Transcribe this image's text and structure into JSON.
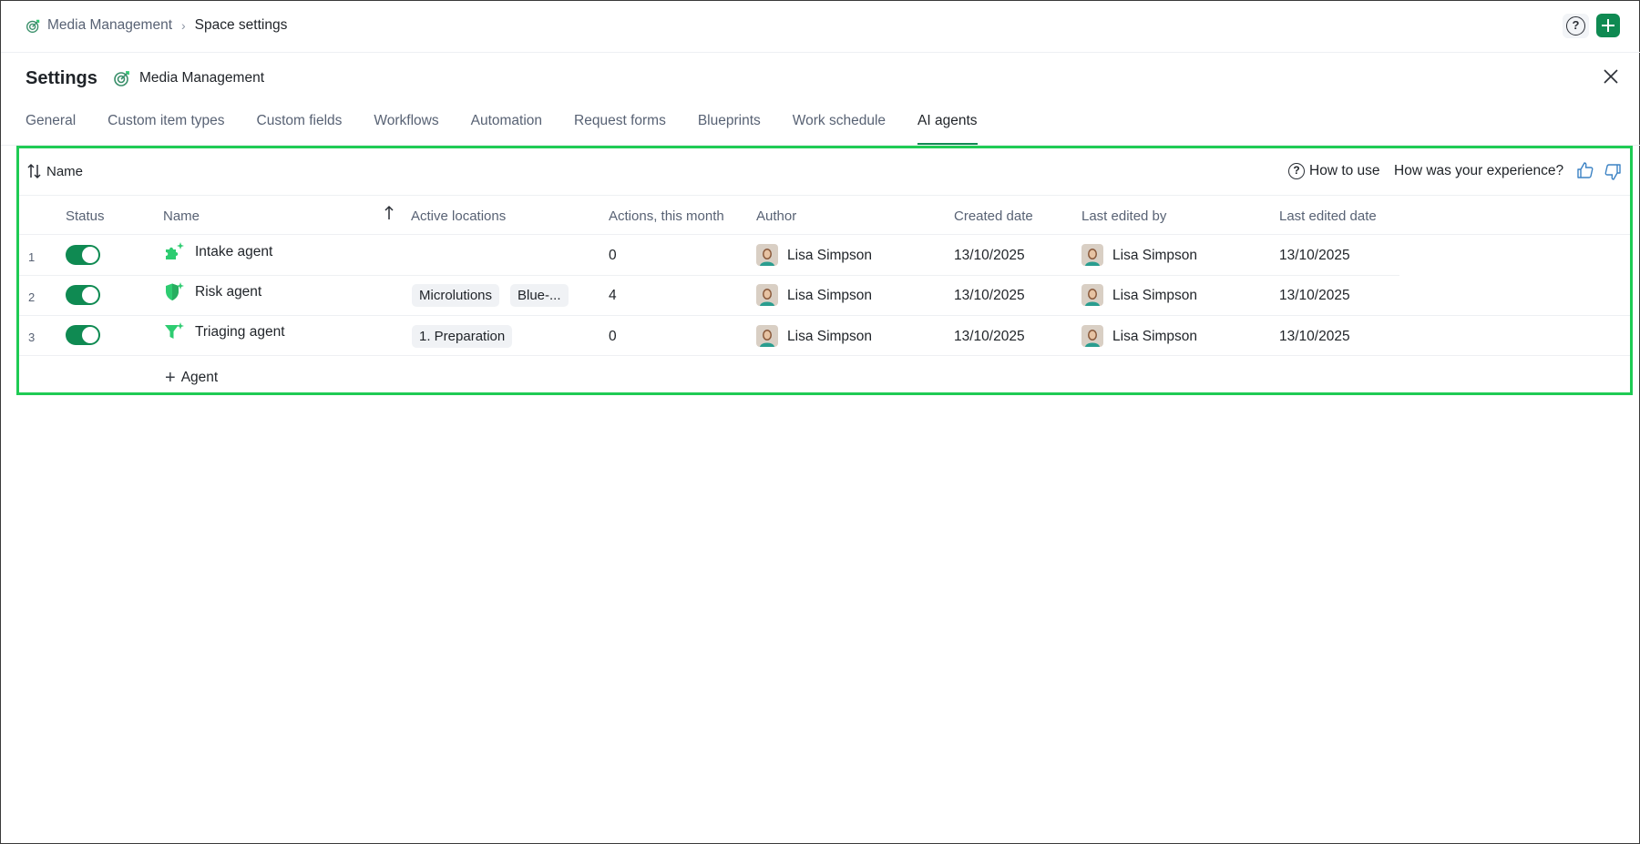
{
  "breadcrumb": {
    "space": "Media Management",
    "page": "Space settings"
  },
  "header": {
    "title": "Settings",
    "space_name": "Media Management"
  },
  "tabs": [
    {
      "label": "General"
    },
    {
      "label": "Custom item types"
    },
    {
      "label": "Custom fields"
    },
    {
      "label": "Workflows"
    },
    {
      "label": "Automation"
    },
    {
      "label": "Request forms"
    },
    {
      "label": "Blueprints"
    },
    {
      "label": "Work schedule"
    },
    {
      "label": "AI agents",
      "active": true
    }
  ],
  "toolbar": {
    "sort_label": "Name",
    "how_to_use": "How to use",
    "experience": "How was your experience?",
    "help_symbol": "?"
  },
  "columns": {
    "status": "Status",
    "name": "Name",
    "active_locations": "Active locations",
    "actions": "Actions, this month",
    "author": "Author",
    "created": "Created date",
    "last_edited_by": "Last edited by",
    "last_edited_date": "Last edited date"
  },
  "rows": [
    {
      "num": "1",
      "enabled": true,
      "icon": "puzzle-sparkle-icon",
      "name": "Intake agent",
      "locations": [],
      "actions": "0",
      "author": "Lisa Simpson",
      "created": "13/10/2025",
      "last_edited_by": "Lisa Simpson",
      "last_edited_date": "13/10/2025"
    },
    {
      "num": "2",
      "enabled": true,
      "icon": "shield-sparkle-icon",
      "name": "Risk agent",
      "locations": [
        "Microlutions",
        "Blue-..."
      ],
      "actions": "4",
      "author": "Lisa Simpson",
      "created": "13/10/2025",
      "last_edited_by": "Lisa Simpson",
      "last_edited_date": "13/10/2025"
    },
    {
      "num": "3",
      "enabled": true,
      "icon": "funnel-sparkle-icon",
      "name": "Triaging agent",
      "locations": [
        "1. Preparation"
      ],
      "actions": "0",
      "author": "Lisa Simpson",
      "created": "13/10/2025",
      "last_edited_by": "Lisa Simpson",
      "last_edited_date": "13/10/2025"
    }
  ],
  "add_agent_label": "Agent",
  "colors": {
    "accent": "#0f8a52",
    "highlight_border": "#1fcb54",
    "muted_text": "#586274",
    "icon_green": "#2ecc71"
  }
}
